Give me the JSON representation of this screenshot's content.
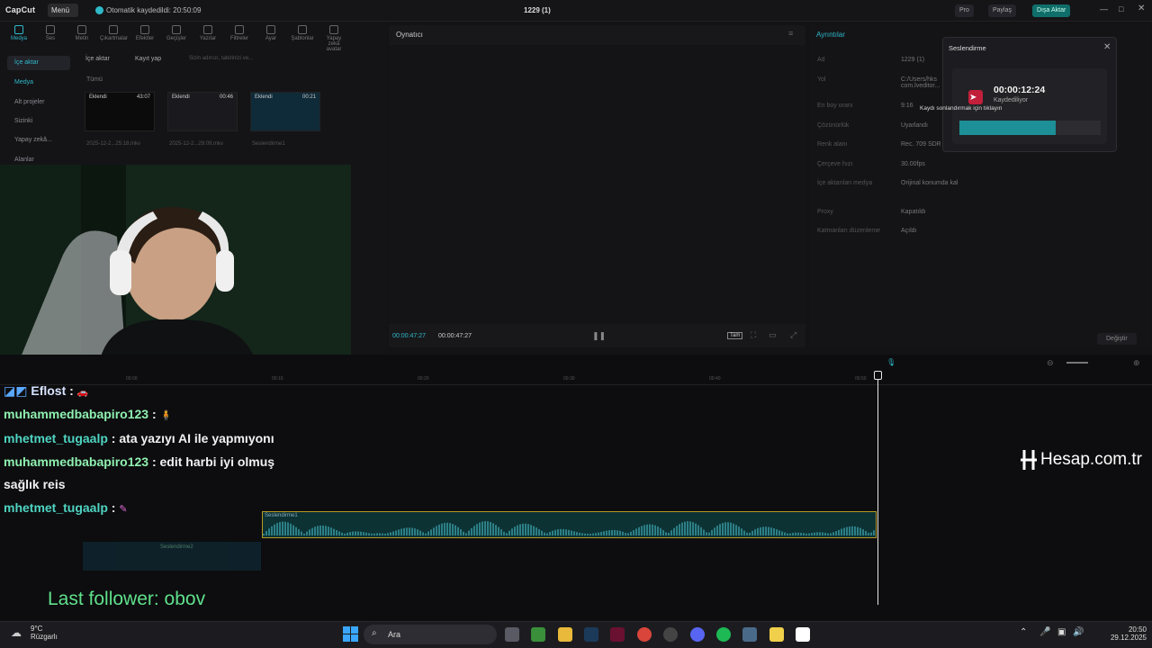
{
  "titlebar": {
    "app_name": "CapCut",
    "menu_label": "Menü",
    "autosave_text": "Otomatik kaydedildi: 20:50:09",
    "project_title": "1229 (1)",
    "pro_label": "Pro",
    "share_label": "Paylaş",
    "export_label": "Dışa Aktar"
  },
  "toolbar": {
    "tools": [
      "Medya",
      "Ses",
      "Metin",
      "Çıkartmalar",
      "Efektler",
      "Geçişler",
      "Yazılar",
      "Filtreler",
      "Ayar",
      "Şablonlar",
      "Yapay zekâ avatar"
    ]
  },
  "media_panel": {
    "import_label": "İçe aktar",
    "record_label": "Kayıt yap",
    "search_placeholder": "Sizin adınızı, tabirinizi ve...",
    "all_label": "Tümü",
    "sidebar": [
      "İçe aktar",
      "Medya",
      "Alt projeler",
      "Sizinki",
      "Yapay zekâ...",
      "Alanlar"
    ],
    "thumbs": [
      {
        "tag": "Eklendi",
        "duration": "43:07",
        "name": "2025-12-2...25:18.mkv"
      },
      {
        "tag": "Eklendi",
        "duration": "00:46",
        "name": "2025-12-2...29:09.mkv"
      },
      {
        "tag": "Eklendi",
        "duration": "00:21",
        "name": "Seslendirme1"
      }
    ]
  },
  "player": {
    "title": "Oynatıcı",
    "time_current": "00:00:47:27",
    "time_total": "00:00:47:27",
    "fit_label": "Tam"
  },
  "details_panel": {
    "title": "Ayrıntılar",
    "rows": [
      {
        "label": "Ad",
        "value": "1229 (1)"
      },
      {
        "label": "Yol",
        "value": "C:/Users/hks\ncom.lveditor..."
      },
      {
        "label": "En boy oranı",
        "value": "9:16"
      },
      {
        "label": "Çözünürlük",
        "value": "Uyarlandı"
      },
      {
        "label": "Renk alanı",
        "value": "Rec. 709 SDR"
      },
      {
        "label": "Çerçeve hızı",
        "value": "30.00fps"
      },
      {
        "label": "İçe aktarılan medya",
        "value": "Orijinal konumda kal"
      },
      {
        "label": "Proxy",
        "value": "Kapatıldı"
      },
      {
        "label": "Katmanları düzenleme",
        "value": "Açıldı"
      }
    ],
    "change_label": "Değiştir"
  },
  "recording_popup": {
    "title": "Seslendirme",
    "elapsed": "00:00:12:24",
    "status": "Kaydediliyor",
    "tooltip": "Kaydı sonlandırmak için tıklayın",
    "level": 0.68,
    "colors": {
      "record": "#c21f3a",
      "meter": "#1c8f97"
    }
  },
  "timeline": {
    "ruler_ticks": [
      "00:00",
      "00:10",
      "00:20",
      "00:30",
      "00:40",
      "00:50"
    ],
    "clip_label": "Seslendirme1",
    "clip2_label": "Seslendirme2"
  },
  "chat_overlay": {
    "messages": [
      {
        "user": "Eflost",
        "text": ""
      },
      {
        "user": "muhammedbabapiro123",
        "text": ""
      },
      {
        "user": "mhetmet_tugaalp",
        "text": "ata yazıyı AI ile yapmıyonı"
      },
      {
        "user": "muhammedbabapiro123",
        "text": "edit harbi iyi olmuş"
      },
      {
        "user": "",
        "text": "sağlık reis"
      },
      {
        "user": "mhetmet_tugaalp",
        "text": ""
      }
    ],
    "last_follower": "Last follower: obov"
  },
  "watermark": {
    "text": "Hesap.com.tr"
  },
  "taskbar": {
    "weather_temp": "9°C",
    "weather_desc": "Rüzgarlı",
    "search_placeholder": "Ara",
    "time": "20:50",
    "date": "29.12.2025"
  }
}
